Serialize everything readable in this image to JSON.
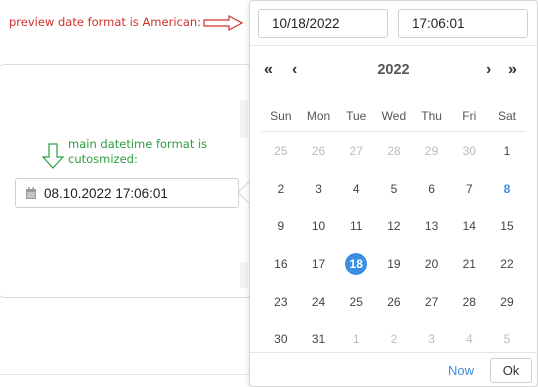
{
  "annotations": {
    "preview_note": "preview date format is American:",
    "main_note": "main datetime format is cutosmized:"
  },
  "main_field": {
    "value": "08.10.2022 17:06:01",
    "icon": "calendar-icon"
  },
  "picker": {
    "date_value": "10/18/2022",
    "time_value": "17:06:01",
    "year": "2022",
    "nav": {
      "prev_year": "«",
      "prev_month": "‹",
      "next_month": "›",
      "next_year": "»"
    },
    "weekdays": [
      "Sun",
      "Mon",
      "Tue",
      "Wed",
      "Thu",
      "Fri",
      "Sat"
    ],
    "weeks": [
      [
        {
          "d": "25",
          "m": true
        },
        {
          "d": "26",
          "m": true
        },
        {
          "d": "27",
          "m": true
        },
        {
          "d": "28",
          "m": true
        },
        {
          "d": "29",
          "m": true
        },
        {
          "d": "30",
          "m": true
        },
        {
          "d": "1"
        }
      ],
      [
        {
          "d": "2"
        },
        {
          "d": "3"
        },
        {
          "d": "4"
        },
        {
          "d": "5"
        },
        {
          "d": "6"
        },
        {
          "d": "7"
        },
        {
          "d": "8",
          "today": true
        }
      ],
      [
        {
          "d": "9"
        },
        {
          "d": "10"
        },
        {
          "d": "11"
        },
        {
          "d": "12"
        },
        {
          "d": "13"
        },
        {
          "d": "14"
        },
        {
          "d": "15"
        }
      ],
      [
        {
          "d": "16"
        },
        {
          "d": "17"
        },
        {
          "d": "18",
          "sel": true
        },
        {
          "d": "19"
        },
        {
          "d": "20"
        },
        {
          "d": "21"
        },
        {
          "d": "22"
        }
      ],
      [
        {
          "d": "23"
        },
        {
          "d": "24"
        },
        {
          "d": "25"
        },
        {
          "d": "26"
        },
        {
          "d": "27"
        },
        {
          "d": "28"
        },
        {
          "d": "29"
        }
      ],
      [
        {
          "d": "30"
        },
        {
          "d": "31"
        },
        {
          "d": "1",
          "m": true
        },
        {
          "d": "2",
          "m": true
        },
        {
          "d": "3",
          "m": true
        },
        {
          "d": "4",
          "m": true
        },
        {
          "d": "5",
          "m": true
        }
      ]
    ],
    "now_label": "Now",
    "ok_label": "Ok"
  },
  "colors": {
    "accent": "#3b8fe0",
    "note_red": "#d0312d",
    "note_green": "#2e9e3e"
  }
}
